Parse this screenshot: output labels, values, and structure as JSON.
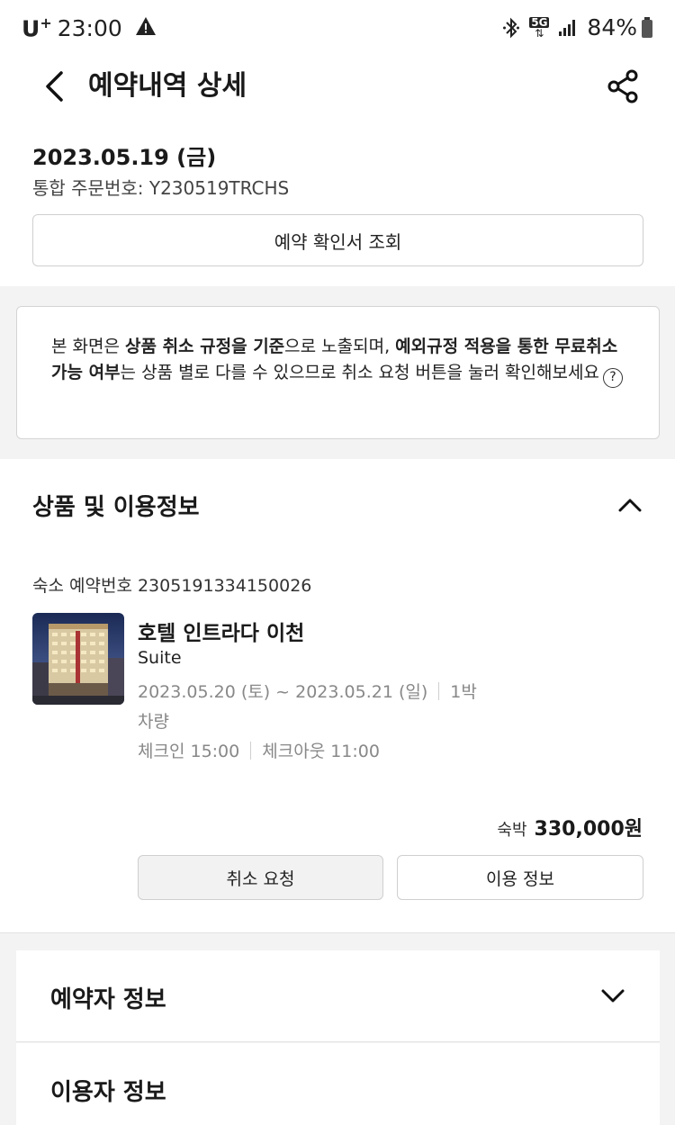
{
  "status_bar": {
    "carrier": "U",
    "carrier_sup": "+",
    "time": "23:00",
    "network": "5G",
    "battery": "84%"
  },
  "header": {
    "title": "예약내역 상세",
    "back_icon": "chevron-left-icon",
    "share_icon": "share-icon"
  },
  "order": {
    "date": "2023.05.19 (금)",
    "number_label": "통합 주문번호: Y230519TRCHS",
    "confirm_button": "예약 확인서 조회"
  },
  "notice": {
    "part1": "본 화면은 ",
    "bold1": "상품 취소 규정을 기준",
    "part2": "으로 노출되며, ",
    "bold2": "예외규정 적용을 통한 무료취소 가능 여부",
    "part3": "는 상품 별로 다를 수 있으므로 취소 요청 버튼을 눌러 확인해보세요",
    "help_glyph": "?"
  },
  "product": {
    "section_title": "상품 및 이용정보",
    "stay_number": "숙소 예약번호 2305191334150026",
    "hotel_name": "호텔 인트라다 이천",
    "room_type": "Suite",
    "dates": "2023.05.20 (토) ~ 2023.05.21 (일)",
    "nights": "1박",
    "transport": "차량",
    "checkin": "체크인 15:00",
    "checkout": "체크아웃 11:00",
    "price_label": "숙박",
    "price": "330,000원",
    "cancel_button": "취소 요청",
    "use_info_button": "이용 정보"
  },
  "booker": {
    "section_title": "예약자 정보"
  },
  "user": {
    "section_title": "이용자 정보"
  },
  "colors": {
    "accent_text": "#1a1a1a",
    "muted_text": "#888888",
    "band": "#f3f3f3"
  }
}
